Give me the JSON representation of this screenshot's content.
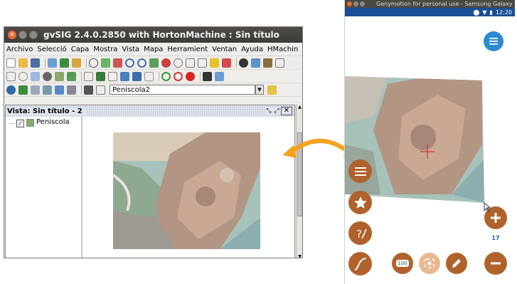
{
  "gvsig": {
    "window_title": "gvSIG 2.4.0.2850 with HortonMachine : Sin título",
    "menus": [
      "Archivo",
      "Selecció",
      "Capa",
      "Mostra",
      "Vista",
      "Mapa",
      "Herramient",
      "Ventan",
      "Ayuda",
      "HMachin"
    ],
    "layer_select_value": "Peniscola2",
    "view_title": "Vista: Sin título - 2",
    "toc_layer": "Peniscola",
    "toc_layer_checked": true
  },
  "genymotion": {
    "window_title": "Genymotion for personal use - Samsung Galaxy",
    "status_time": "12:20",
    "zoom_level": "17",
    "scale_badge": "100"
  },
  "colors": {
    "fab_brown": "#b0622c",
    "fab_blue": "#2a8ad2",
    "arrow_orange": "#f5a21c",
    "status_bar_blue": "#1b4f95"
  }
}
